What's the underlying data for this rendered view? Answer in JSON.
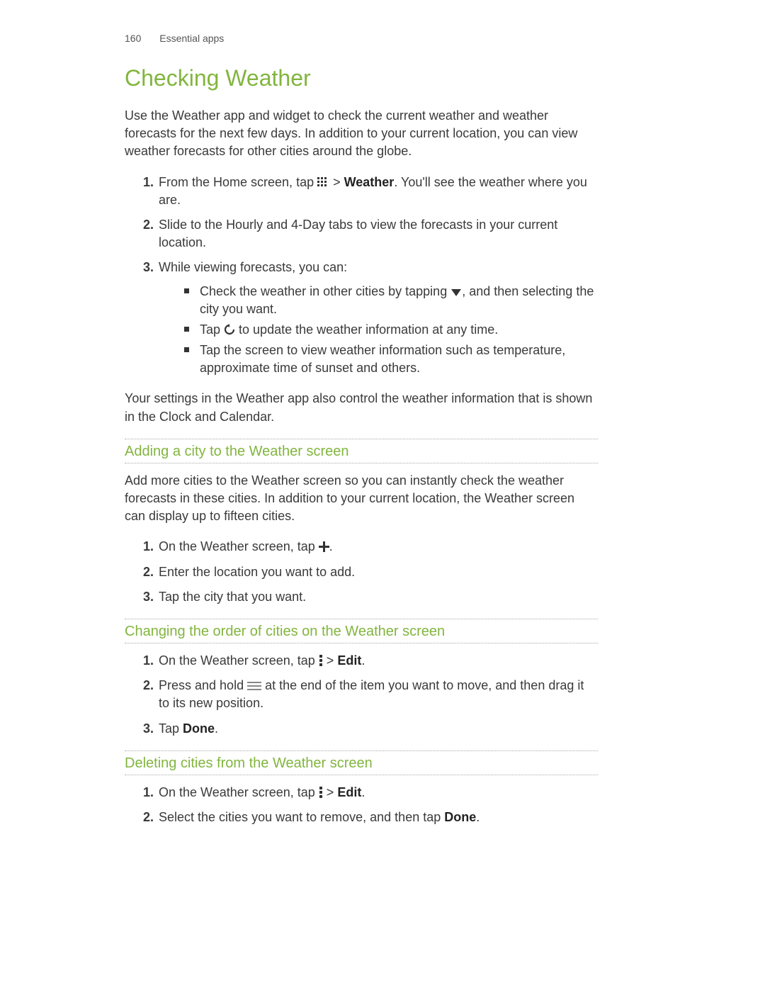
{
  "header": {
    "page_number": "160",
    "section": "Essential apps"
  },
  "title": "Checking Weather",
  "intro": "Use the Weather app and widget to check the current weather and weather forecasts for the next few days. In addition to your current location, you can view weather forecasts for other cities around the globe.",
  "step1": {
    "a": "From the Home screen, tap ",
    "b": " > ",
    "weather": "Weather",
    "c": ". You'll see the weather where you are."
  },
  "step2": "Slide to the Hourly and 4-Day tabs to view the forecasts in your current location.",
  "step3": {
    "lead": "While viewing forecasts, you can:",
    "b1a": "Check the weather in other cities by tapping ",
    "b1b": ", and then selecting the city you want.",
    "b2a": "Tap ",
    "b2b": " to update the weather information at any time.",
    "b3": "Tap the screen to view weather information such as temperature, approximate time of sunset and others."
  },
  "note": "Your settings in the Weather app also control the weather information that is shown in the Clock and Calendar.",
  "sec_add": {
    "heading": "Adding a city to the Weather screen",
    "intro": "Add more cities to the Weather screen so you can instantly check the weather forecasts in these cities. In addition to your current location, the Weather screen can display up to fifteen cities.",
    "s1a": "On the Weather screen, tap ",
    "s1b": ".",
    "s2": "Enter the location you want to add.",
    "s3": "Tap the city that you want."
  },
  "sec_order": {
    "heading": "Changing the order of cities on the Weather screen",
    "s1a": "On the Weather screen, tap ",
    "s1b": " > ",
    "edit": "Edit",
    "s1c": ".",
    "s2a": "Press and hold ",
    "s2b": " at the end of the item you want to move, and then drag it to its new position.",
    "s3a": "Tap ",
    "done": "Done",
    "s3b": "."
  },
  "sec_del": {
    "heading": "Deleting cities from the Weather screen",
    "s1a": "On the Weather screen, tap ",
    "s1b": " > ",
    "edit": "Edit",
    "s1c": ".",
    "s2a": "Select the cities you want to remove, and then tap ",
    "done": "Done",
    "s2b": "."
  }
}
